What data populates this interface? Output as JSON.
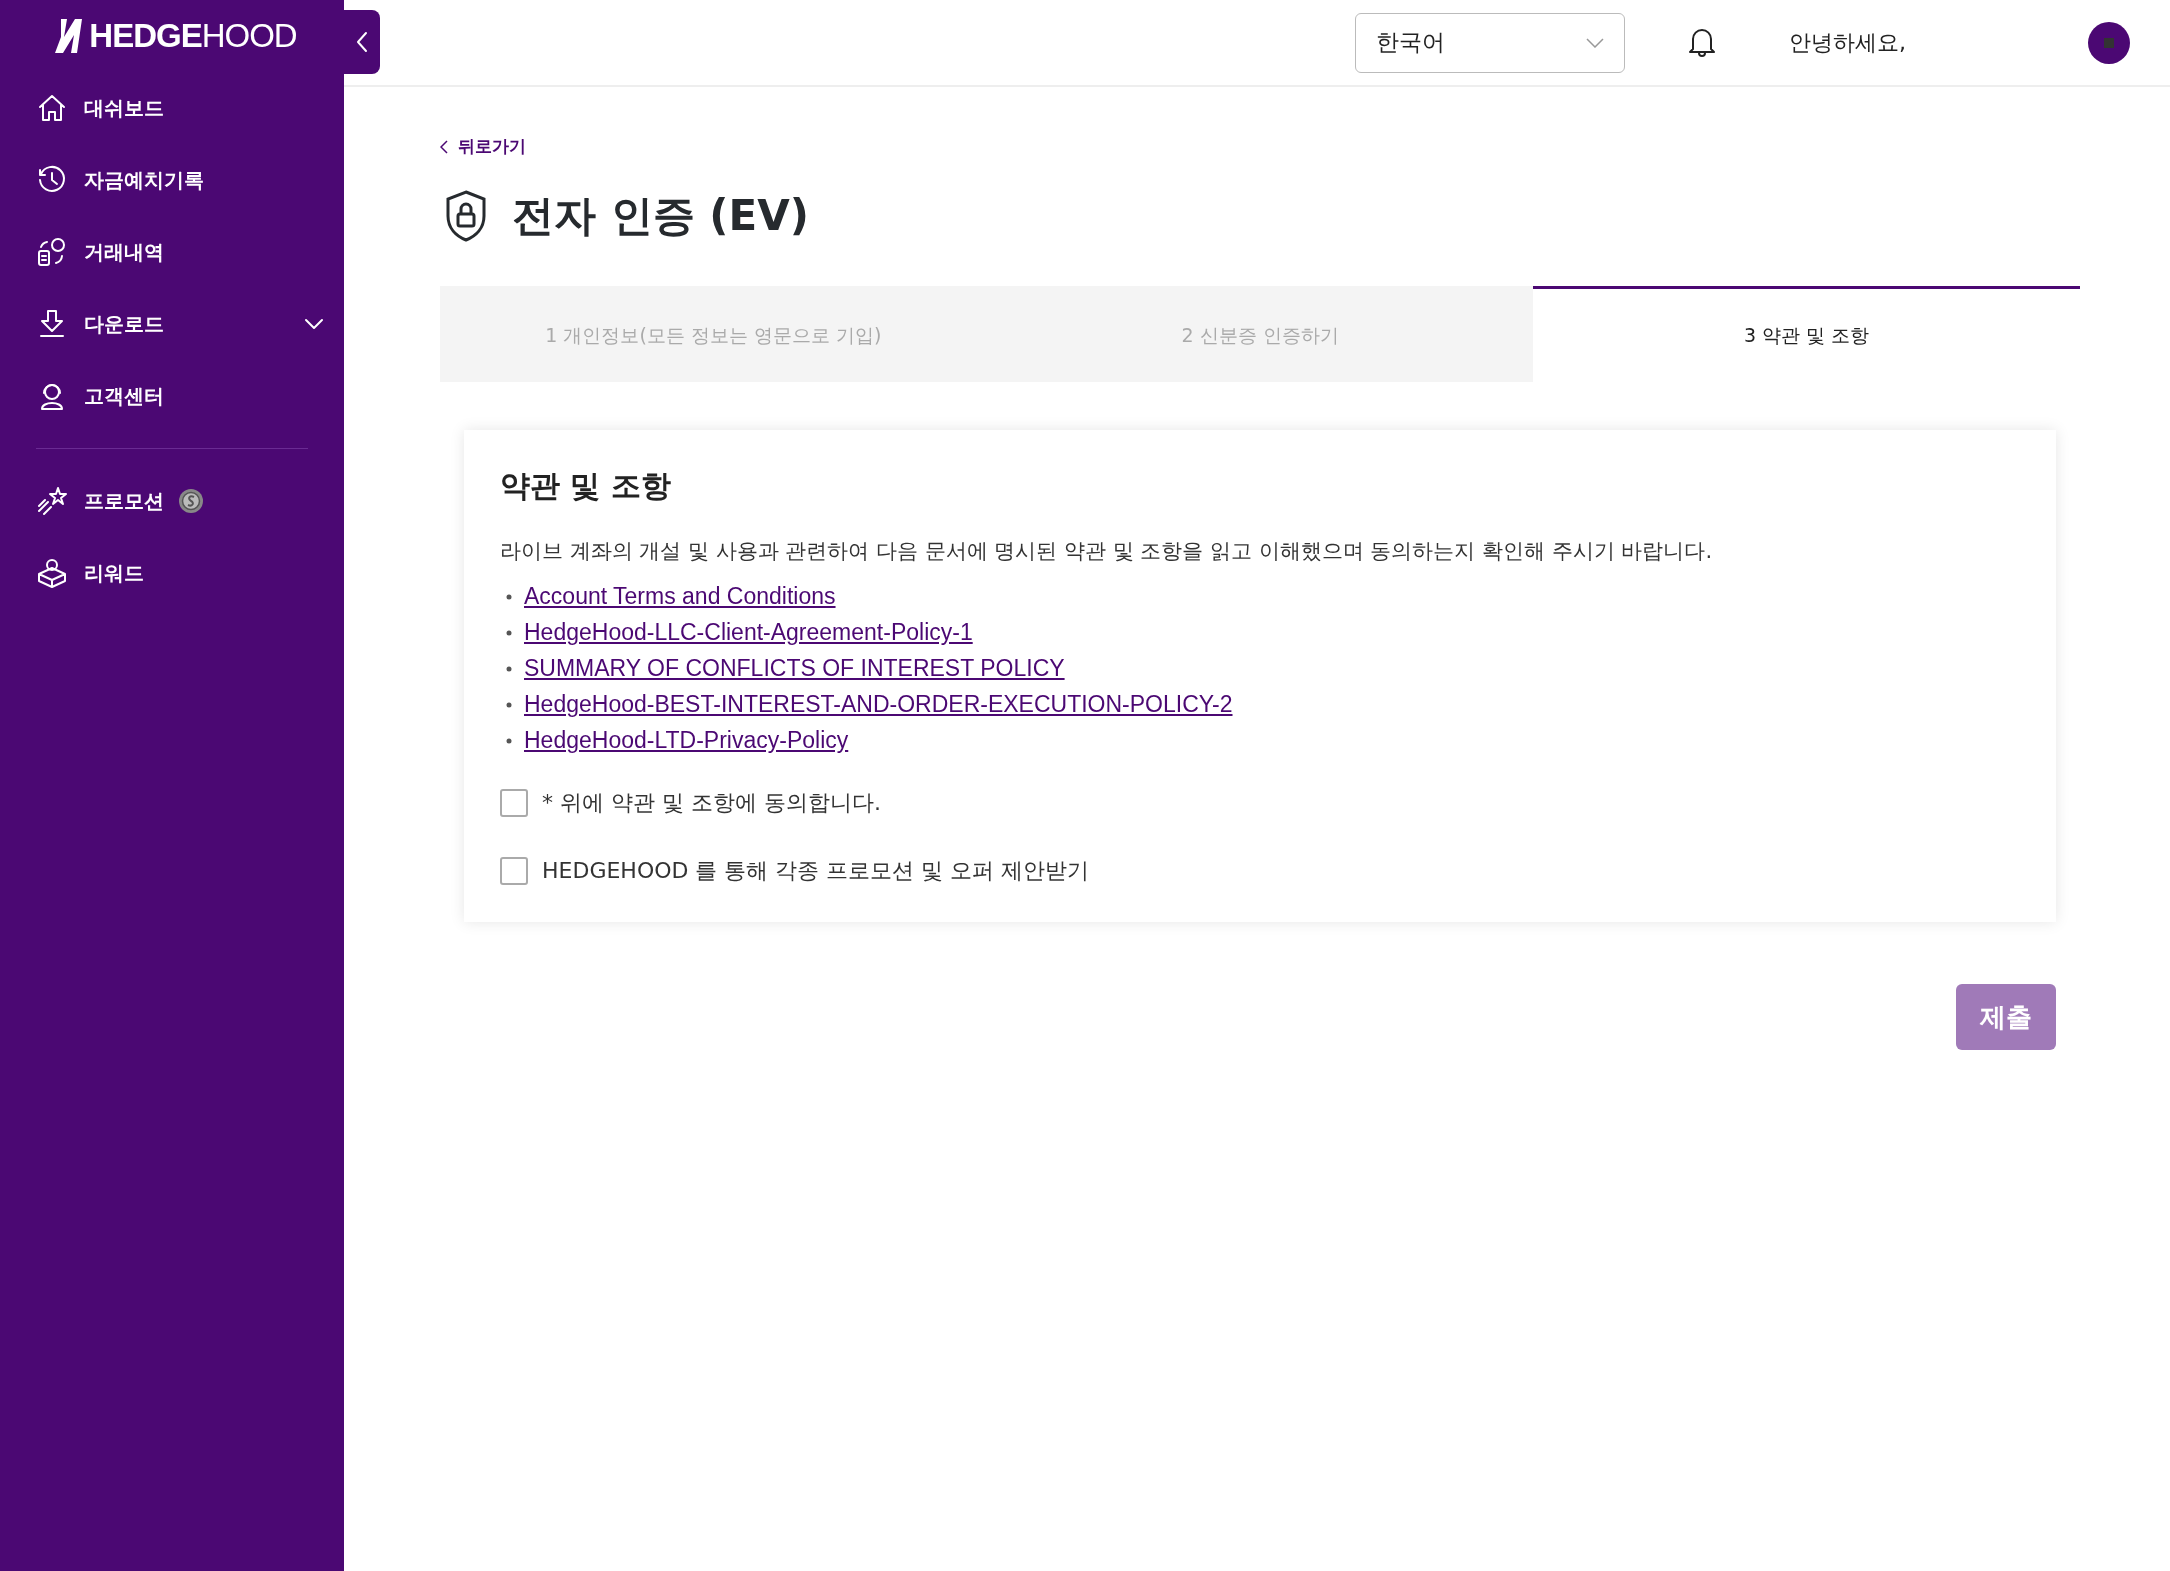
{
  "sidebar": {
    "logo": "**HEDGE**HOOD",
    "items": [
      {
        "label": "대쉬보드",
        "selected": false
      },
      {
        "label": "자금예치기록",
        "selected": false
      },
      {
        "label": "거래내역",
        "selected": false
      },
      {
        "label": "다운로드",
        "selected": false,
        "expanded": false
      },
      {
        "label": "고객센터",
        "selected": false
      }
    ],
    "extra_items": [
      {
        "label": "프로모션",
        "selected": false,
        "badge": true
      },
      {
        "label": "리워드",
        "selected": false
      }
    ]
  },
  "header": {
    "language": "한국어",
    "greeting": "안녕하세요,"
  },
  "back_link": "뒤로가기",
  "page_title": "전자 인증 (EV)",
  "steps": [
    {
      "label": "1 개인정보(모든 정보는 영문으로 기입)",
      "selected": false
    },
    {
      "label": "2 신분증 인증하기",
      "selected": false
    },
    {
      "label": "3 약관 및 조항",
      "selected": true
    }
  ],
  "card": {
    "title": "약관 및 조항",
    "intro": "라이브 계좌의 개설 및 사용과 관련하여 다음 문서에 명시된 약관 및 조항을 읽고 이해했으며 동의하는지 확인해 주시기 바랍니다.",
    "links": [
      "Account Terms and Conditions",
      "HedgeHood-LLC-Client-Agreement-Policy-1",
      "SUMMARY OF CONFLICTS OF INTEREST POLICY",
      "HedgeHood-BEST-INTEREST-AND-ORDER-EXECUTION-POLICY-2",
      "HedgeHood-LTD-Privacy-Policy"
    ],
    "checkboxes": [
      {
        "label": "* 위에 약관 및 조항에 동의합니다.",
        "checked": false
      },
      {
        "label": "HEDGEHOOD 를 통해 각종 프로모션 및 오퍼 제안받기",
        "checked": false
      }
    ]
  },
  "submit": {
    "label": "제출",
    "disabled": true
  }
}
